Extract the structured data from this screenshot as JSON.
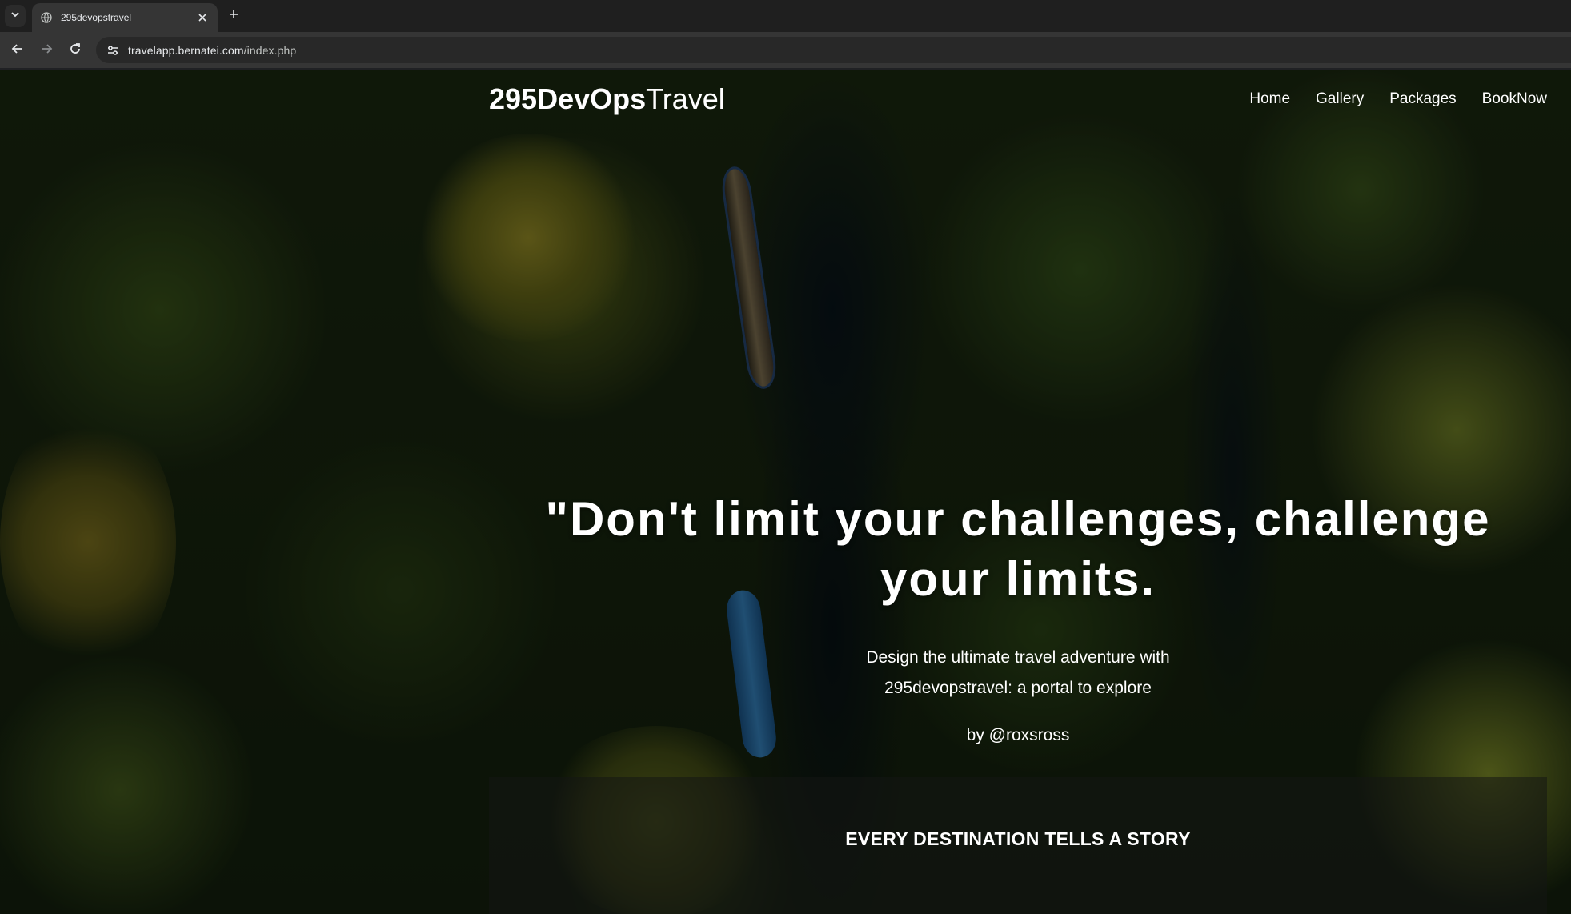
{
  "browser": {
    "tab_title": "295devopstravel",
    "url_host": "travelapp.bernatei.com",
    "url_path": "/index.php",
    "icons": {
      "tab_search": "chevron-down-icon",
      "favicon": "globe-icon",
      "close": "close-icon",
      "new_tab": "plus-icon",
      "back": "back-arrow-icon",
      "forward": "forward-arrow-icon",
      "reload": "reload-icon",
      "site_info": "tune-icon"
    }
  },
  "site": {
    "logo_bold": "295DevOps",
    "logo_light": "Travel",
    "nav": [
      "Home",
      "Gallery",
      "Packages",
      "BookNow"
    ]
  },
  "hero": {
    "quote": "\"Don't limit your challenges, challenge your limits.",
    "subtitle_line1": "Design the ultimate travel adventure with",
    "subtitle_line2": "295devopstravel: a portal to explore",
    "byline": "by @roxsross"
  },
  "story": {
    "title": "EVERY DESTINATION TELLS A STORY"
  },
  "colors": {
    "chrome_bg": "#1f1f1f",
    "toolbar_bg": "#353535",
    "text": "#ffffff"
  }
}
